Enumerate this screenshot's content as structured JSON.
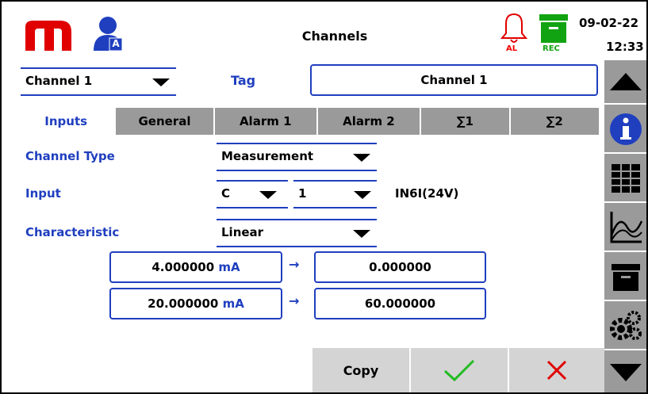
{
  "header": {
    "title": "Channels",
    "date": "09-02-22",
    "time": "12:33",
    "alarm_label": "AL",
    "rec_label": "REC",
    "logo_icon": "m-logo-icon",
    "user_icon": "user-admin-icon",
    "user_badge": "A"
  },
  "channel_select": {
    "value": "Channel 1"
  },
  "tag": {
    "label": "Tag",
    "value": "Channel 1"
  },
  "tabs": [
    "Inputs",
    "General",
    "Alarm 1",
    "Alarm 2",
    "∑1",
    "∑2"
  ],
  "form": {
    "channel_type_label": "Channel Type",
    "channel_type_value": "Measurement",
    "input_label": "Input",
    "input_port": "C",
    "input_number": "1",
    "input_module": "IN6I(24V)",
    "characteristic_label": "Characteristic",
    "characteristic_value": "Linear"
  },
  "scaling": [
    {
      "input_value": "4.000000",
      "unit": "mA",
      "arrow": "→",
      "output_value": "0.000000"
    },
    {
      "input_value": "20.000000",
      "unit": "mA",
      "arrow": "→",
      "output_value": "60.000000"
    }
  ],
  "buttons": {
    "copy": "Copy"
  },
  "sidebar_icons": [
    "scroll-up-icon",
    "info-icon",
    "table-view-icon",
    "chart-view-icon",
    "archive-icon",
    "settings-icon",
    "scroll-down-icon"
  ],
  "colors": {
    "accent": "#1f3fbf",
    "alarm": "#e00000",
    "rec": "#12a312",
    "sidebar": "#9a9a9a"
  }
}
